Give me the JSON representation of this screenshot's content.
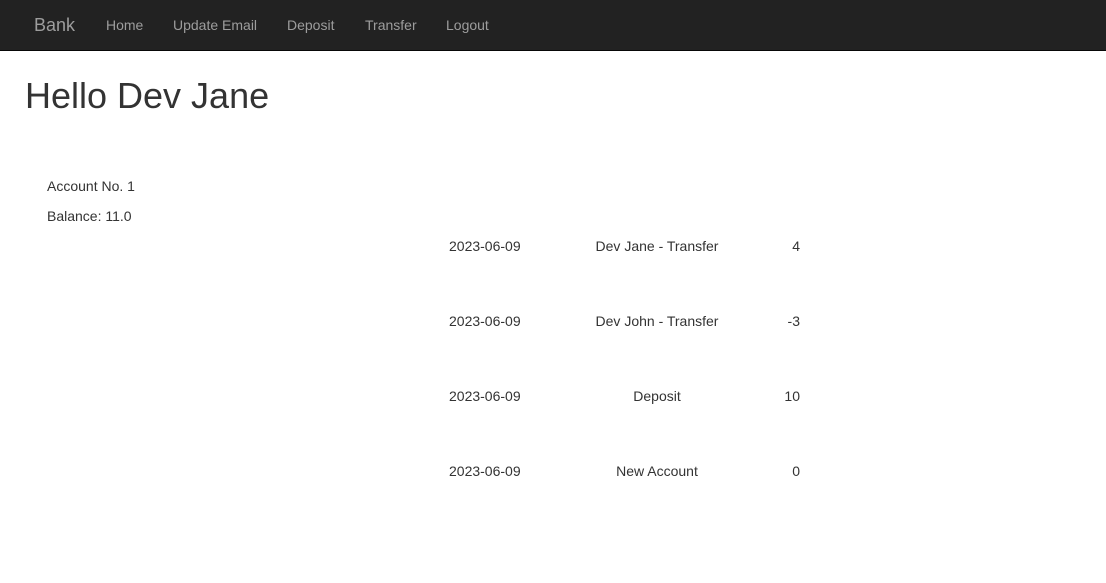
{
  "navbar": {
    "brand": "Bank",
    "links": [
      "Home",
      "Update Email",
      "Deposit",
      "Transfer",
      "Logout"
    ]
  },
  "main": {
    "greeting": "Hello Dev Jane",
    "account_number": "Account No. 1",
    "balance": "Balance: 11.0"
  },
  "transactions": [
    {
      "date": "2023-06-09",
      "description": "Dev Jane - Transfer",
      "amount": "4"
    },
    {
      "date": "2023-06-09",
      "description": "Dev John - Transfer",
      "amount": "-3"
    },
    {
      "date": "2023-06-09",
      "description": "Deposit",
      "amount": "10"
    },
    {
      "date": "2023-06-09",
      "description": "New Account",
      "amount": "0"
    }
  ],
  "colors": {
    "navbar_bg": "#222222",
    "navbar_text": "#9d9d9d",
    "body_text": "#333333"
  }
}
